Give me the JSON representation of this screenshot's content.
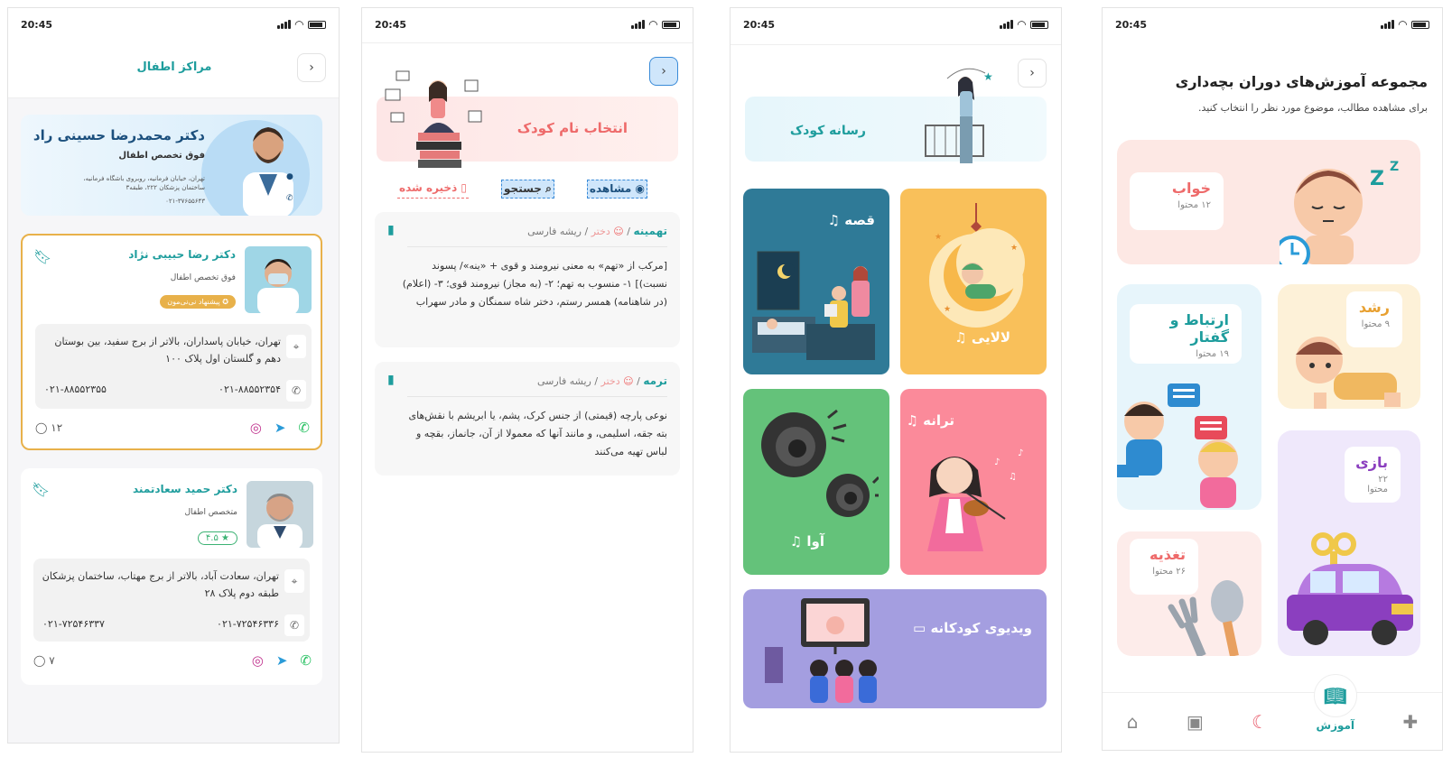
{
  "status": {
    "time": "20:45"
  },
  "screen1": {
    "title": "مراکز اطفال",
    "banner": {
      "name": "دکتر محمدرضا حسینی راد",
      "specialty": "فوق تخصص اطفال",
      "address": "تهران، خیابان فرمانیه، روبروی باشگاه فرمانیه، ساختمان پزشکان ۲۲۲، طبقه۳",
      "phone": "۰۲۱-۳۷۶۵۵۶۴۳"
    },
    "doctors": [
      {
        "name": "دکتر رضا حبیبی نژاد",
        "specialty": "فوق تخصص اطفال",
        "badge": "پیشنهاد نی‌نی‌مون",
        "address": "تهران، خیابان پاسداران، بالاتر از برج سفید، بین بوستان دهم و گلستان اول پلاک ۱۰۰",
        "phone1": "۰۲۱-۸۸۵۵۲۳۵۴",
        "phone2": "۰۲۱-۸۸۵۵۲۳۵۵",
        "comments": "۱۲"
      },
      {
        "name": "دکتر حمید سعادتمند",
        "specialty": "متخصص اطفال",
        "rating": "۴.۵",
        "address": "تهران، سعادت آباد، بالاتر از برج مهتاب، ساختمان پزشکان طبقه دوم پلاک ۲۸",
        "phone1": "۰۲۱-۷۲۵۴۶۳۳۶",
        "phone2": "۰۲۱-۷۲۵۴۶۳۳۷",
        "comments": "۷"
      }
    ]
  },
  "screen2": {
    "banner_title": "انتخاب نام کودک",
    "tab_view": "مشاهده",
    "tab_search": "جستجو",
    "tab_saved": "ذخیره شده",
    "names": [
      {
        "name": "تهمینه",
        "gender": "دختر",
        "root": "ریشه فارسی",
        "meaning": "[مرکب از «تهم» به معنی نیرومند و قوی + «ینه»/ پسوند نسبت)] ۱- منسوب به تهم؛ ۲- (به مجاز) نیرومند قوی؛ ۳- (اعلام) (در شاهنامه) همسر رستم، دختر شاه سمنگان و مادر سهراب"
      },
      {
        "name": "ترمه",
        "gender": "دختر",
        "root": "ریشه فارسی",
        "meaning": "نوعی پارچه (قیمتی) از جنس کرک، پشم، یا ابریشم با نقش‌های بته جقه، اسلیمی، و مانند آنها که معمولا از آن، جانماز، بقچه و لباس تهیه می‌کنند"
      }
    ]
  },
  "screen3": {
    "banner_title": "رسانه کودک",
    "tiles": {
      "lullaby": "لالایی",
      "story": "قصه",
      "song": "ترانه",
      "sound": "آوا",
      "video": "ویدیوی کودکانه"
    }
  },
  "screen4": {
    "title": "مجموعه آموزش‌های دوران بچه‌داری",
    "subtitle": "برای مشاهده مطالب، موضوع مورد نظر را انتخاب کنید.",
    "categories": {
      "sleep": {
        "title": "خواب",
        "count": "۱۲ محتوا"
      },
      "growth": {
        "title": "رشد",
        "count": "۹ محتوا"
      },
      "talk": {
        "title": "ارتباط و گفتار",
        "count": "۱۹ محتوا"
      },
      "play": {
        "title": "بازی",
        "count": "۲۲ محتوا"
      },
      "food": {
        "title": "تغذیه",
        "count": "۲۶ محتوا"
      }
    },
    "nav_active": "آموزش"
  },
  "colors": {
    "teal": "#1e9d9d",
    "pink": "#ee6a6a",
    "gold": "#e8b14a",
    "tile_lullaby": "#f9c05a",
    "tile_story": "#2f7a97",
    "tile_song": "#fb8a9a",
    "tile_sound": "#64c27a",
    "tile_video": "#a49ee0"
  }
}
